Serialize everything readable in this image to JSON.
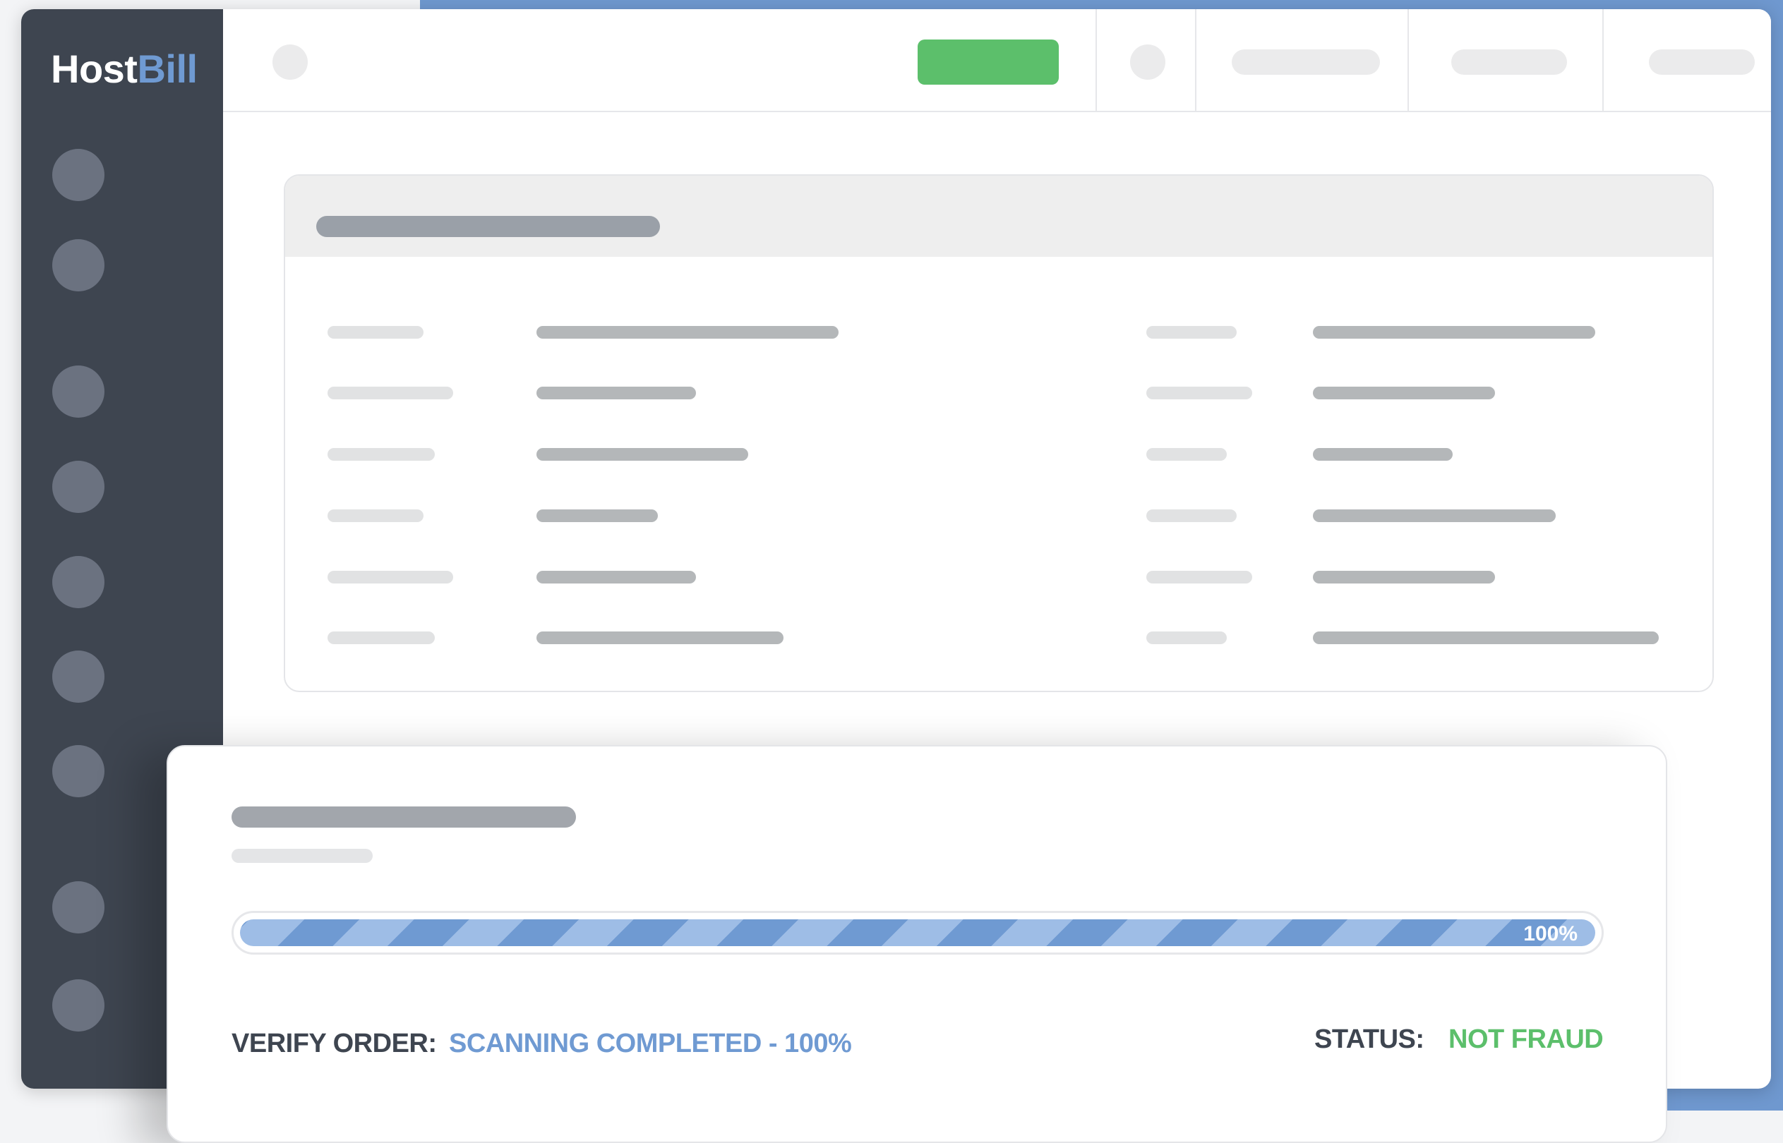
{
  "brand": {
    "name_part1": "Host",
    "name_part2": "Bill",
    "accent_color": "#6f9ad2"
  },
  "sidebar": {
    "background": "#3e4550",
    "items": [
      {
        "icon": "nav-item-icon"
      },
      {
        "icon": "nav-item-icon"
      },
      {
        "icon": "nav-item-icon"
      },
      {
        "icon": "nav-item-icon"
      },
      {
        "icon": "nav-item-icon"
      },
      {
        "icon": "nav-item-icon"
      },
      {
        "icon": "nav-item-icon"
      },
      {
        "icon": "nav-item-icon"
      },
      {
        "icon": "nav-item-icon"
      }
    ]
  },
  "topbar": {
    "primary_action_color": "#5cbf6b"
  },
  "fraud_check": {
    "progress_percent": 100,
    "progress_label": "100%",
    "verify_label": "VERIFY ORDER:",
    "verify_value": "SCANNING COMPLETED - 100%",
    "status_label": "STATUS:",
    "status_value": "NOT FRAUD",
    "status_color": "#5cbf6b",
    "progress_color": "#6f9ad2"
  }
}
